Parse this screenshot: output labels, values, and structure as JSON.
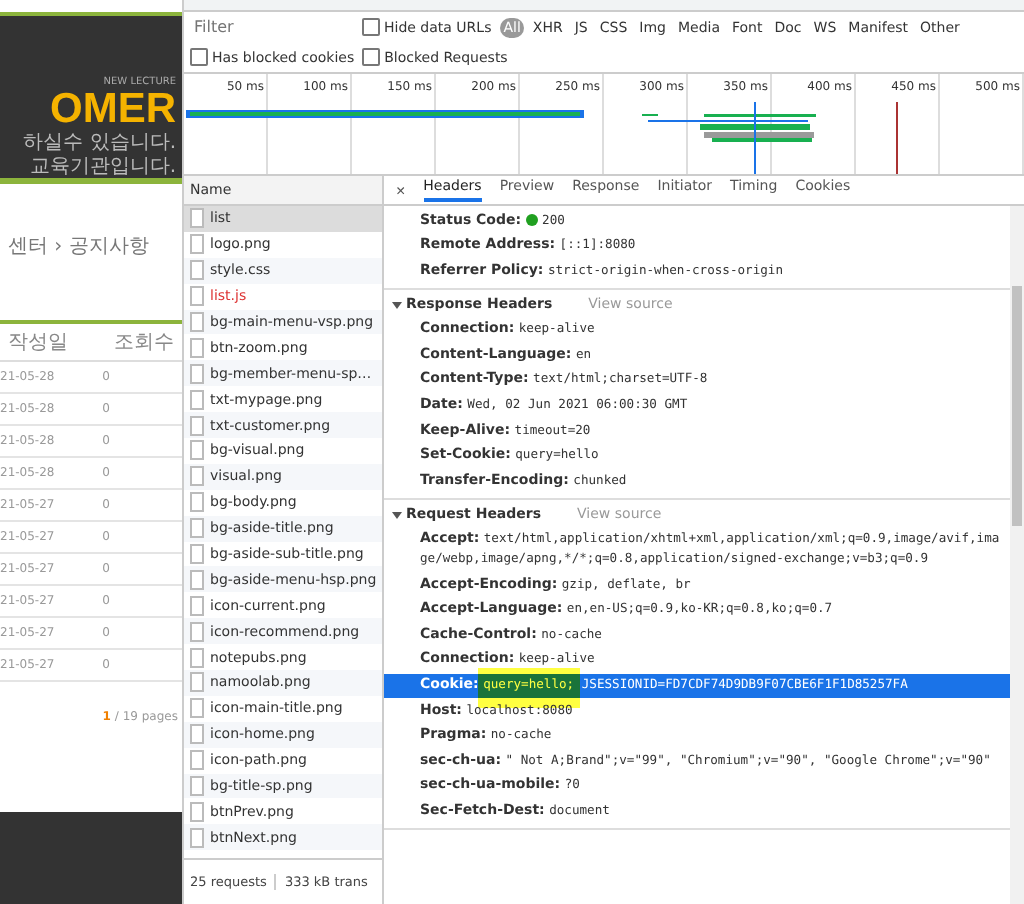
{
  "web_page": {
    "banner": {
      "tagline": "NEW LECTURE",
      "title": "OMER",
      "lines": [
        "하실수 있습니다.",
        "교육기관입니다."
      ]
    },
    "breadcrumb": "센터 › 공지사항",
    "table": {
      "columns": [
        "작성일",
        "조회수"
      ],
      "rows": [
        {
          "date": "21-05-28",
          "views": "0"
        },
        {
          "date": "21-05-28",
          "views": "0"
        },
        {
          "date": "21-05-28",
          "views": "0"
        },
        {
          "date": "21-05-28",
          "views": "0"
        },
        {
          "date": "21-05-27",
          "views": "0"
        },
        {
          "date": "21-05-27",
          "views": "0"
        },
        {
          "date": "21-05-27",
          "views": "0"
        },
        {
          "date": "21-05-27",
          "views": "0"
        },
        {
          "date": "21-05-27",
          "views": "0"
        },
        {
          "date": "21-05-27",
          "views": "0"
        }
      ]
    },
    "pagination": {
      "current": "1",
      "rest": "/ 19 pages"
    }
  },
  "devtools": {
    "filter": {
      "placeholder": "Filter",
      "hide_data_urls": {
        "label": "Hide data URLs",
        "checked": false
      },
      "types": [
        {
          "label": "All",
          "selected": true
        },
        {
          "label": "XHR",
          "selected": false
        },
        {
          "label": "JS",
          "selected": false
        },
        {
          "label": "CSS",
          "selected": false
        },
        {
          "label": "Img",
          "selected": false
        },
        {
          "label": "Media",
          "selected": false
        },
        {
          "label": "Font",
          "selected": false
        },
        {
          "label": "Doc",
          "selected": false
        },
        {
          "label": "WS",
          "selected": false
        },
        {
          "label": "Manifest",
          "selected": false
        },
        {
          "label": "Other",
          "selected": false
        }
      ],
      "options": [
        {
          "label": "Has blocked cookies",
          "checked": false
        },
        {
          "label": "Blocked Requests",
          "checked": false
        }
      ]
    },
    "timeline": {
      "ticks": [
        "50 ms",
        "100 ms",
        "150 ms",
        "200 ms",
        "250 ms",
        "300 ms",
        "350 ms",
        "400 ms",
        "450 ms",
        "500 ms"
      ]
    },
    "requests": {
      "column": "Name",
      "items": [
        {
          "name": "list",
          "selected": true,
          "failed": false
        },
        {
          "name": "logo.png",
          "selected": false,
          "failed": false
        },
        {
          "name": "style.css",
          "selected": false,
          "failed": false
        },
        {
          "name": "list.js",
          "selected": false,
          "failed": true
        },
        {
          "name": "bg-main-menu-vsp.png",
          "selected": false,
          "failed": false
        },
        {
          "name": "btn-zoom.png",
          "selected": false,
          "failed": false
        },
        {
          "name": "bg-member-menu-sp…",
          "selected": false,
          "failed": false
        },
        {
          "name": "txt-mypage.png",
          "selected": false,
          "failed": false
        },
        {
          "name": "txt-customer.png",
          "selected": false,
          "failed": false
        },
        {
          "name": "bg-visual.png",
          "selected": false,
          "failed": false
        },
        {
          "name": "visual.png",
          "selected": false,
          "failed": false
        },
        {
          "name": "bg-body.png",
          "selected": false,
          "failed": false
        },
        {
          "name": "bg-aside-title.png",
          "selected": false,
          "failed": false
        },
        {
          "name": "bg-aside-sub-title.png",
          "selected": false,
          "failed": false
        },
        {
          "name": "bg-aside-menu-hsp.png",
          "selected": false,
          "failed": false
        },
        {
          "name": "icon-current.png",
          "selected": false,
          "failed": false
        },
        {
          "name": "icon-recommend.png",
          "selected": false,
          "failed": false
        },
        {
          "name": "notepubs.png",
          "selected": false,
          "failed": false
        },
        {
          "name": "namoolab.png",
          "selected": false,
          "failed": false
        },
        {
          "name": "icon-main-title.png",
          "selected": false,
          "failed": false
        },
        {
          "name": "icon-home.png",
          "selected": false,
          "failed": false
        },
        {
          "name": "icon-path.png",
          "selected": false,
          "failed": false
        },
        {
          "name": "bg-title-sp.png",
          "selected": false,
          "failed": false
        },
        {
          "name": "btnPrev.png",
          "selected": false,
          "failed": false
        },
        {
          "name": "btnNext.png",
          "selected": false,
          "failed": false
        }
      ],
      "status": [
        "25 requests",
        "333 kB trans"
      ]
    },
    "detail": {
      "close": "×",
      "tabs": [
        {
          "label": "Headers",
          "selected": true
        },
        {
          "label": "Preview",
          "selected": false
        },
        {
          "label": "Response",
          "selected": false
        },
        {
          "label": "Initiator",
          "selected": false
        },
        {
          "label": "Timing",
          "selected": false
        },
        {
          "label": "Cookies",
          "selected": false
        }
      ],
      "sections": [
        {
          "rows": [
            {
              "kind": "status",
              "name": "Status Code:",
              "value": "200",
              "selected": false,
              "marked": false
            },
            {
              "kind": "plain",
              "name": "Remote Address:",
              "value": "[::1]:8080",
              "selected": false,
              "marked": false
            },
            {
              "kind": "plain",
              "name": "Referrer Policy:",
              "value": "strict-origin-when-cross-origin",
              "selected": false,
              "marked": false
            }
          ]
        },
        {
          "title": "Response Headers",
          "view_source": "View source",
          "expanded": true,
          "rows": [
            {
              "kind": "plain",
              "name": "Connection:",
              "value": "keep-alive",
              "selected": false,
              "marked": false
            },
            {
              "kind": "plain",
              "name": "Content-Language:",
              "value": "en",
              "selected": false,
              "marked": false
            },
            {
              "kind": "plain",
              "name": "Content-Type:",
              "value": "text/html;charset=UTF-8",
              "selected": false,
              "marked": false
            },
            {
              "kind": "plain",
              "name": "Date:",
              "value": "Wed, 02 Jun 2021 06:00:30 GMT",
              "selected": false,
              "marked": false
            },
            {
              "kind": "plain",
              "name": "Keep-Alive:",
              "value": "timeout=20",
              "selected": false,
              "marked": false
            },
            {
              "kind": "plain",
              "name": "Set-Cookie:",
              "value": "query=hello",
              "selected": false,
              "marked": false
            },
            {
              "kind": "plain",
              "name": "Transfer-Encoding:",
              "value": "chunked",
              "selected": false,
              "marked": false
            }
          ]
        },
        {
          "title": "Request Headers",
          "view_source": "View source",
          "expanded": true,
          "rows": [
            {
              "kind": "plain",
              "name": "Accept:",
              "value": "text/html,application/xhtml+xml,application/xml;q=0.9,image/avif,image/webp,image/apng,*/*;q=0.8,application/signed-exchange;v=b3;q=0.9",
              "selected": false,
              "marked": false
            },
            {
              "kind": "plain",
              "name": "Accept-Encoding:",
              "value": "gzip, deflate, br",
              "selected": false,
              "marked": false
            },
            {
              "kind": "plain",
              "name": "Accept-Language:",
              "value": "en,en-US;q=0.9,ko-KR;q=0.8,ko;q=0.7",
              "selected": false,
              "marked": false
            },
            {
              "kind": "plain",
              "name": "Cache-Control:",
              "value": "no-cache",
              "selected": false,
              "marked": false
            },
            {
              "kind": "plain",
              "name": "Connection:",
              "value": "keep-alive",
              "selected": false,
              "marked": false
            },
            {
              "kind": "plain",
              "name": "Cookie:",
              "value": "query=hello; JSESSIONID=FD7CDF74D9DB9F07CBE6F1F1D85257FA",
              "selected": true,
              "marked": true
            },
            {
              "kind": "plain",
              "name": "Host:",
              "value": "localhost:8080",
              "selected": false,
              "marked": false
            },
            {
              "kind": "plain",
              "name": "Pragma:",
              "value": "no-cache",
              "selected": false,
              "marked": false
            },
            {
              "kind": "plain",
              "name": "sec-ch-ua:",
              "value": "\" Not A;Brand\";v=\"99\", \"Chromium\";v=\"90\", \"Google Chrome\";v=\"90\"",
              "selected": false,
              "marked": false
            },
            {
              "kind": "plain",
              "name": "sec-ch-ua-mobile:",
              "value": "?0",
              "selected": false,
              "marked": false
            },
            {
              "kind": "plain",
              "name": "Sec-Fetch-Dest:",
              "value": "document",
              "selected": false,
              "marked": false
            }
          ]
        }
      ]
    }
  }
}
